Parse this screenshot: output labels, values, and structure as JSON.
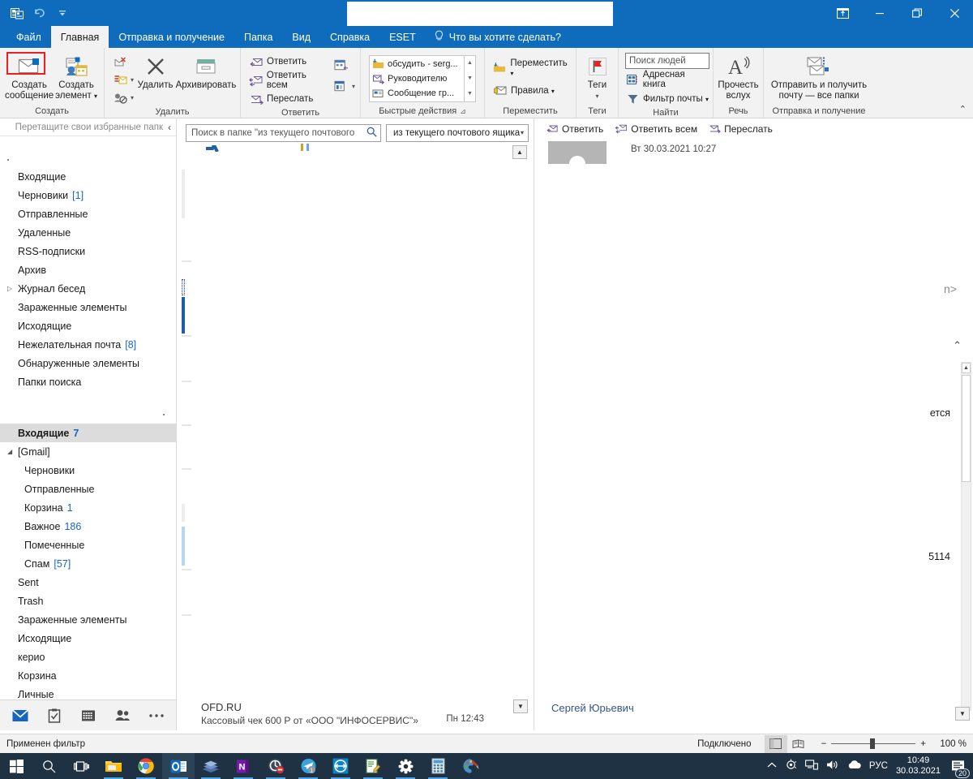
{
  "window": {
    "quick_access": [
      {
        "name": "outlook-logo-icon",
        "glyph": "outlook"
      },
      {
        "name": "undo-icon",
        "glyph": "undo"
      },
      {
        "name": "customize-qat-icon",
        "glyph": "chevron-down-bar"
      }
    ],
    "title_value": "",
    "controls": [
      {
        "name": "ribbon-display-options-button",
        "glyph": "restore-box"
      },
      {
        "name": "minimize-button",
        "glyph": "minimize"
      },
      {
        "name": "restore-button",
        "glyph": "restore"
      },
      {
        "name": "close-button",
        "glyph": "close"
      }
    ]
  },
  "tabs": [
    {
      "label": "Файл",
      "active": false,
      "highlighted": true
    },
    {
      "label": "Главная",
      "active": true,
      "highlighted": false
    },
    {
      "label": "Отправка и получение",
      "active": false,
      "highlighted": false
    },
    {
      "label": "Папка",
      "active": false,
      "highlighted": false
    },
    {
      "label": "Вид",
      "active": false,
      "highlighted": false
    },
    {
      "label": "Справка",
      "active": false,
      "highlighted": false
    },
    {
      "label": "ESET",
      "active": false,
      "highlighted": false
    }
  ],
  "tell_me": "Что вы хотите сделать?",
  "ribbon": {
    "groups": {
      "create": {
        "label": "Создать",
        "new_message": "Создать\nсообщение",
        "new_message_l1": "Создать",
        "new_message_l2": "сообщение",
        "new_item_l1": "Создать",
        "new_item_l2": "элемент"
      },
      "delete": {
        "label": "Удалить",
        "ignore": "",
        "cleanup": "",
        "junk": "",
        "delete_label": "Удалить",
        "archive_label": "Архивировать"
      },
      "reply": {
        "label": "Ответить",
        "reply": "Ответить",
        "reply_all": "Ответить всем",
        "forward": "Переслать"
      },
      "quick_steps": {
        "label": "Быстрые действия",
        "items": [
          "обсудить - serg...",
          "Руководителю",
          "Сообщение гр..."
        ]
      },
      "move": {
        "label": "Переместить",
        "move": "Переместить",
        "rules": "Правила"
      },
      "tags": {
        "label": "Теги",
        "tags_l1": "Теги"
      },
      "find": {
        "label": "Найти",
        "people_search_placeholder": "Поиск людей",
        "address_book": "Адресная книга",
        "mail_filter": "Фильтр почты"
      },
      "speech": {
        "label": "Речь",
        "read_aloud_l1": "Прочесть",
        "read_aloud_l2": "вслух"
      },
      "send_receive": {
        "label": "Отправка и получение",
        "send_receive_l1": "Отправить и получить",
        "send_receive_l2": "почту — все папки"
      }
    }
  },
  "nav_pane": {
    "favorites_hint": "Перетащите свои избранные папк",
    "collapse_glyph": "‹",
    "account1_folders": [
      {
        "label": "Входящие",
        "count": "",
        "expandable": false,
        "indent": false,
        "selected": false
      },
      {
        "label": "Черновики",
        "count": "[1]",
        "expandable": false,
        "indent": false,
        "selected": false
      },
      {
        "label": "Отправленные",
        "count": "",
        "expandable": false,
        "indent": false,
        "selected": false
      },
      {
        "label": "Удаленные",
        "count": "",
        "expandable": false,
        "indent": false,
        "selected": false
      },
      {
        "label": "RSS-подписки",
        "count": "",
        "expandable": false,
        "indent": false,
        "selected": false
      },
      {
        "label": "Архив",
        "count": "",
        "expandable": false,
        "indent": false,
        "selected": false
      },
      {
        "label": "Журнал бесед",
        "count": "",
        "expandable": true,
        "indent": false,
        "selected": false
      },
      {
        "label": "Зараженные элементы",
        "count": "",
        "expandable": false,
        "indent": false,
        "selected": false
      },
      {
        "label": "Исходящие",
        "count": "",
        "expandable": false,
        "indent": false,
        "selected": false
      },
      {
        "label": "Нежелательная почта",
        "count": "[8]",
        "expandable": false,
        "indent": false,
        "selected": false
      },
      {
        "label": "Обнаруженные элементы",
        "count": "",
        "expandable": false,
        "indent": false,
        "selected": false
      },
      {
        "label": "Папки поиска",
        "count": "",
        "expandable": false,
        "indent": false,
        "selected": false
      }
    ],
    "account2_folders": [
      {
        "label": "Входящие",
        "count": "7",
        "expandable": false,
        "indent": false,
        "selected": true
      },
      {
        "label": "[Gmail]",
        "count": "",
        "expandable": true,
        "expanded": true,
        "indent": false,
        "selected": false
      },
      {
        "label": "Черновики",
        "count": "",
        "expandable": false,
        "indent": true,
        "selected": false
      },
      {
        "label": "Отправленные",
        "count": "",
        "expandable": false,
        "indent": true,
        "selected": false
      },
      {
        "label": "Корзина",
        "count": "1",
        "expandable": false,
        "indent": true,
        "selected": false
      },
      {
        "label": "Важное",
        "count": "186",
        "expandable": false,
        "indent": true,
        "selected": false
      },
      {
        "label": "Помеченные",
        "count": "",
        "expandable": false,
        "indent": true,
        "selected": false
      },
      {
        "label": "Спам",
        "count": "[57]",
        "expandable": false,
        "indent": true,
        "selected": false
      },
      {
        "label": "Sent",
        "count": "",
        "expandable": false,
        "indent": false,
        "selected": false
      },
      {
        "label": "Trash",
        "count": "",
        "expandable": false,
        "indent": false,
        "selected": false
      },
      {
        "label": "Зараженные элементы",
        "count": "",
        "expandable": false,
        "indent": false,
        "selected": false
      },
      {
        "label": "Исходящие",
        "count": "",
        "expandable": false,
        "indent": false,
        "selected": false
      },
      {
        "label": "керио",
        "count": "",
        "expandable": false,
        "indent": false,
        "selected": false
      },
      {
        "label": "Корзина",
        "count": "",
        "expandable": false,
        "indent": false,
        "selected": false
      },
      {
        "label": "Личные",
        "count": "",
        "expandable": false,
        "indent": false,
        "selected": false
      }
    ],
    "bottom_nav": [
      {
        "name": "mail-icon",
        "active": true
      },
      {
        "name": "calendar-tasks-icon",
        "active": false
      },
      {
        "name": "calendar-icon",
        "active": false
      },
      {
        "name": "people-icon",
        "active": false
      },
      {
        "name": "more-options-icon",
        "active": false
      }
    ]
  },
  "message_list": {
    "search_placeholder": "Поиск в папке \"из текущего почтового",
    "search_value": "",
    "scope_value": "из текущего почтового ящика",
    "last_message": {
      "sender": "OFD.RU",
      "subject": "Кассовый чек 600 Р от «ООО \"ИНФОСЕРВИС\"»",
      "date": "Пн 12:43"
    }
  },
  "reading_pane": {
    "actions": [
      {
        "label": "Ответить",
        "name": "reply-button"
      },
      {
        "label": "Ответить всем",
        "name": "reply-all-button"
      },
      {
        "label": "Переслать",
        "name": "forward-button"
      }
    ],
    "received_date": "Вт 30.03.2021 10:27",
    "fragment_top": "n>",
    "fragment_mid": "ется",
    "fragment_num": "5114",
    "signature": "Сергей Юрьевич"
  },
  "status_bar": {
    "left_text": "Применен фильтр",
    "connected": "Подключено",
    "zoom_pct": "100 %",
    "zoom_minus": "−",
    "zoom_plus": "+"
  },
  "taskbar": {
    "items": [
      {
        "name": "start-button",
        "glyph": "windows",
        "active": false,
        "running": false
      },
      {
        "name": "search-taskbar-icon",
        "glyph": "search",
        "active": false,
        "running": false
      },
      {
        "name": "task-view-icon",
        "glyph": "taskview",
        "active": false,
        "running": false
      },
      {
        "name": "file-explorer-icon",
        "glyph": "explorer",
        "active": false,
        "running": true
      },
      {
        "name": "chrome-icon",
        "glyph": "chrome",
        "active": false,
        "running": true
      },
      {
        "name": "outlook-taskbar-icon",
        "glyph": "outlook",
        "active": true,
        "running": true
      },
      {
        "name": "books-app-icon",
        "glyph": "books",
        "active": false,
        "running": true
      },
      {
        "name": "onenote-icon",
        "glyph": "onenote",
        "active": false,
        "running": true
      },
      {
        "name": "security-app-icon",
        "glyph": "security",
        "active": false,
        "running": true
      },
      {
        "name": "telegram-icon",
        "glyph": "telegram",
        "active": false,
        "running": true
      },
      {
        "name": "teamviewer-icon",
        "glyph": "teamviewer",
        "active": false,
        "running": true
      },
      {
        "name": "notepad-editor-icon",
        "glyph": "editor",
        "active": false,
        "running": true
      },
      {
        "name": "settings-gear-icon",
        "glyph": "gear",
        "active": false,
        "running": true
      },
      {
        "name": "calculator-icon",
        "glyph": "calc",
        "active": false,
        "running": true
      },
      {
        "name": "paint-icon",
        "glyph": "paint",
        "active": false,
        "running": false
      }
    ],
    "tray": {
      "lang": "РУС",
      "time": "10:49",
      "date": "30.03.2021",
      "notification_count": "20"
    }
  },
  "colors": {
    "accent": "#0f6cbd",
    "ribbon_bg": "#f2f2f2",
    "taskbar": "#1f3243",
    "link": "#1566c0",
    "highlight_red": "#e8221f"
  }
}
